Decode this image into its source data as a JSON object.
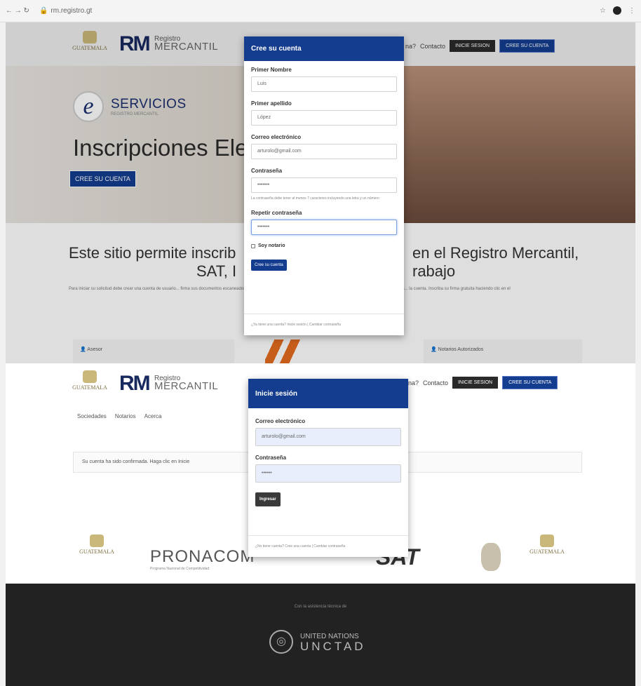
{
  "browser": {
    "nav_glyphs": "←  →  ↻",
    "url": "rm.registro.gt",
    "star_glyph": "☆",
    "menu_glyph": "⋮"
  },
  "header": {
    "guatemala_logo": "GUATEMALA",
    "rm_logo": "RM",
    "registro_small": "Registro",
    "registro_big": "MERCANTIL",
    "nav_q": "na?",
    "nav_contact": "Contacto",
    "login_btn": "INICIE SESION",
    "create_btn": "CREE SU CUENTA"
  },
  "hero": {
    "eservicios": "SERVICIOS",
    "eservicios_sub": "REGISTRO MERCANTIL",
    "title": "Inscripciones Ele",
    "cta": "CREE SU CUENTA"
  },
  "lead": {
    "left_line1": "Este sitio permite inscrib",
    "left_line2": "SAT, I",
    "right_line1": "en el Registro Mercantil,",
    "right_line2": "rabajo",
    "small": "Para iniciar su solicitud debe crear una cuenta de usuario... firma sus documentos escaneados y escoger el notario que autorice los documentos. Los notarios registrados aparecen... la cuenta. Inscriba su firma gratuita haciendo clic en el"
  },
  "features": {
    "left": "Asesor",
    "right": "Notarios Autorizados"
  },
  "second_header": {
    "nav_q": "na?",
    "nav_contact": "Contacto",
    "login_btn": "INICIE SESION",
    "create_btn": "CREE SU CUENTA",
    "subnav": [
      "Sociedades",
      "Notarios",
      "Acerca"
    ],
    "confirmation": "Su cuenta ha sido confirmada. Haga clic en Inicie"
  },
  "partners": {
    "pronacom": "PRONACOM",
    "pronacom_sub": "Programa Nacional de Competitividad",
    "sat": "SAT",
    "guatemala_left": "GUATEMALA",
    "guatemala_right": "GUATEMALA"
  },
  "footer": {
    "assist": "Con la asistencia técnica de",
    "un": "UNITED NATIONS",
    "unctad": "UNCTAD"
  },
  "signup_modal": {
    "title": "Cree su cuenta",
    "first_name_label": "Primer Nombre",
    "first_name_value": "Luis",
    "last_name_label": "Primer apellido",
    "last_name_value": "López",
    "email_label": "Correo electrónico",
    "email_value": "arturolo@gmail.com",
    "password_label": "Contraseña",
    "password_value": "•••••••",
    "password_hint": "La contraseña debe tener al menos 7 caracteres incluyendo una letra y un número",
    "repeat_label": "Repetir contraseña",
    "repeat_value": "•••••••",
    "notary_label": "Soy notario",
    "submit": "Cree su cuenta",
    "footer": "¿Ya tiene una cuenta? Inicie sesión | Cambiar contraseña"
  },
  "login_modal": {
    "title": "Inicie sesión",
    "email_label": "Correo electrónico",
    "email_value": "arturolo@gmail.com",
    "password_label": "Contraseña",
    "password_value": "••••••",
    "submit": "Ingresar",
    "footer": "¿No tiene cuenta? Cree una cuenta | Cambiar contraseña"
  }
}
